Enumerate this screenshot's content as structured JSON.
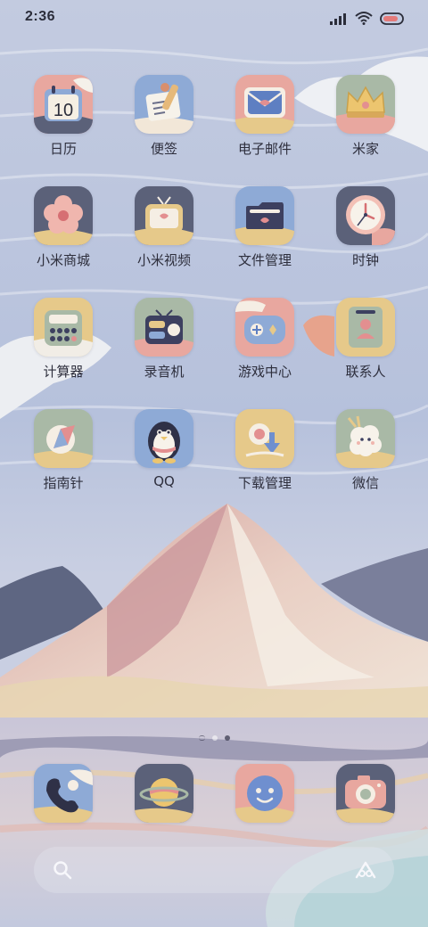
{
  "status_bar": {
    "time": "2:36",
    "signal_icon": "cellular-signal-icon",
    "wifi_icon": "wifi-icon",
    "battery_icon": "battery-icon"
  },
  "apps": [
    {
      "label": "日历",
      "icon": "calendar-icon",
      "icon_text": "10"
    },
    {
      "label": "便签",
      "icon": "notes-icon"
    },
    {
      "label": "电子邮件",
      "icon": "email-icon"
    },
    {
      "label": "米家",
      "icon": "crown-icon"
    },
    {
      "label": "小米商城",
      "icon": "flower-icon"
    },
    {
      "label": "小米视频",
      "icon": "tv-icon"
    },
    {
      "label": "文件管理",
      "icon": "folder-icon"
    },
    {
      "label": "时钟",
      "icon": "clock-icon"
    },
    {
      "label": "计算器",
      "icon": "calculator-icon"
    },
    {
      "label": "录音机",
      "icon": "radio-icon"
    },
    {
      "label": "游戏中心",
      "icon": "gamepad-icon"
    },
    {
      "label": "联系人",
      "icon": "contact-icon"
    },
    {
      "label": "指南针",
      "icon": "compass-icon"
    },
    {
      "label": "QQ",
      "icon": "penguin-icon"
    },
    {
      "label": "下载管理",
      "icon": "download-icon"
    },
    {
      "label": "微信",
      "icon": "chat-bubble-icon"
    }
  ],
  "page_indicator": {
    "pages": 3,
    "current": 3
  },
  "dock": [
    {
      "icon": "phone-icon"
    },
    {
      "icon": "planet-icon"
    },
    {
      "icon": "smiley-message-icon"
    },
    {
      "icon": "camera-icon"
    }
  ],
  "search_bar": {
    "search_icon": "search-icon",
    "assistant_icon": "assistant-icon"
  },
  "colors": {
    "sky": "#b9c4de",
    "mountain": "#d9b3ae",
    "icon_pink": "#e3a09a",
    "icon_blue": "#8eaad6",
    "icon_yellow": "#e6c98a",
    "icon_sage": "#a9b9a6",
    "icon_navy": "#5b6179",
    "text": "#2e2f3d"
  }
}
